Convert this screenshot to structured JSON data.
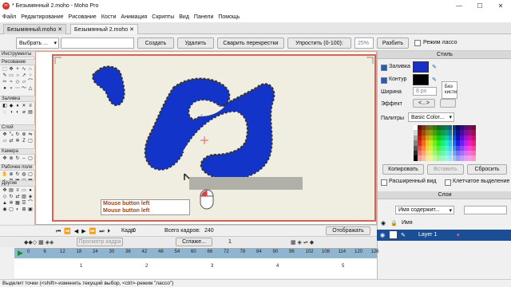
{
  "window": {
    "title": "* Безымянный 2.moho - Moho Pro",
    "app_icon": "moho-logo-icon",
    "buttons": [
      "minimize-icon",
      "maximize-icon",
      "close-icon"
    ]
  },
  "menu": [
    "Файл",
    "Редактирование",
    "Рисование",
    "Кости",
    "Анимация",
    "Скрипты",
    "Вид",
    "Панели",
    "Помощь"
  ],
  "tabs": [
    {
      "label": "Безымянный.moho ✕",
      "active": false
    },
    {
      "label": "Безымянный 2.moho ✕",
      "active": true
    }
  ],
  "toolbar": {
    "select_dropdown": "Выбрать ...",
    "create": "Создать",
    "delete": "Удалить",
    "weld": "Сварить перекрестки",
    "simplify": "Упростить (0-100):",
    "simplify_value": "25%",
    "split": "Разбить",
    "lasso_label": "Режим лассо"
  },
  "tools": {
    "header": "Инструменты",
    "sections": [
      "Рисование",
      "Заливка",
      "Слой",
      "Камера",
      "Рабочее поле",
      "Другие"
    ]
  },
  "canvas": {
    "hint_line1": "Mouse button left",
    "hint_line2": "Mouse button left",
    "fill_color": "#1234c8"
  },
  "style": {
    "header": "Стиль",
    "fill_label": "Заливка",
    "stroke_label": "Контур",
    "width_label": "Ширина",
    "width_value": "8 px",
    "no_brush": "Без кисти",
    "effect_label": "Эффект",
    "effect_value": "<...>",
    "palettes_label": "Палитры",
    "palette_value": "Basic Color...",
    "copy": "Копировать",
    "paste": "Вставить",
    "reset": "Сбросить",
    "advanced": "Расширенный вид",
    "cell_select": "Клетчатое выделение",
    "fill_color": "#1830c8",
    "stroke_color": "#000000"
  },
  "layers": {
    "header": "Слои",
    "search_placeholder": "Имя содержит...",
    "name_col": "Имя",
    "layer_name": "Layer 1"
  },
  "playback": {
    "frame_label": "Кадр:",
    "frame_value": "0",
    "total_label": "Всего кадров:",
    "total_value": "240",
    "display": "Отображать"
  },
  "timeline_bar": {
    "view_frame": "Просмотр кадра",
    "smooth": "Сглаже...",
    "value": "1"
  },
  "ruler": [
    "0",
    "6",
    "12",
    "18",
    "24",
    "30",
    "36",
    "42",
    "48",
    "54",
    "60",
    "66",
    "72",
    "78",
    "84",
    "90",
    "96",
    "102",
    "108",
    "114",
    "120",
    "126"
  ],
  "ruler_sub": [
    "1",
    "2",
    "3",
    "4",
    "5"
  ],
  "status": "Выделит точки (<shift>-изменить текущий выбор, <ctrl>-режим \"лассо\")"
}
